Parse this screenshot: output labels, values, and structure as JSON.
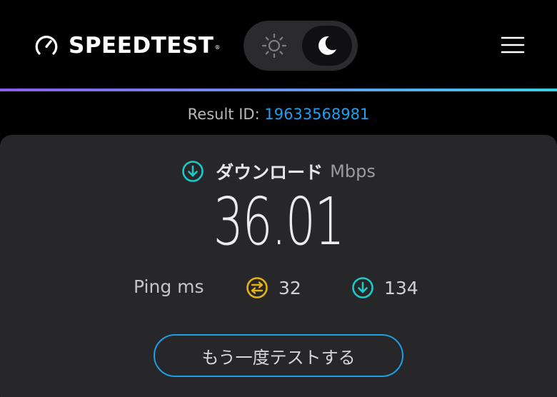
{
  "header": {
    "logo_text": "SPEEDTEST",
    "logo_trademark": "®",
    "logo_icon": "speedometer-icon",
    "theme_toggle": {
      "light_icon": "sun-icon",
      "dark_icon": "moon-icon",
      "selected": "dark"
    },
    "menu_icon": "hamburger-menu-icon"
  },
  "result": {
    "label": "Result ID: ",
    "id": "19633568981"
  },
  "download": {
    "icon": "download-arrow-icon",
    "label": "ダウンロード",
    "unit": "Mbps",
    "value": "36.01"
  },
  "ping": {
    "label": "Ping ms",
    "idle_icon": "ping-idle-icon",
    "idle_value": "32",
    "download_icon": "ping-download-icon",
    "download_value": "134"
  },
  "actions": {
    "retest_label": "もう一度テストする"
  },
  "colors": {
    "accent_blue": "#1da1ee",
    "download_teal": "#1fc8c8",
    "ping_gold": "#e3b316",
    "gradient_start": "#8c5cf0",
    "gradient_end": "#39d0e8",
    "card_bg": "#272729",
    "page_bg": "#000000"
  }
}
